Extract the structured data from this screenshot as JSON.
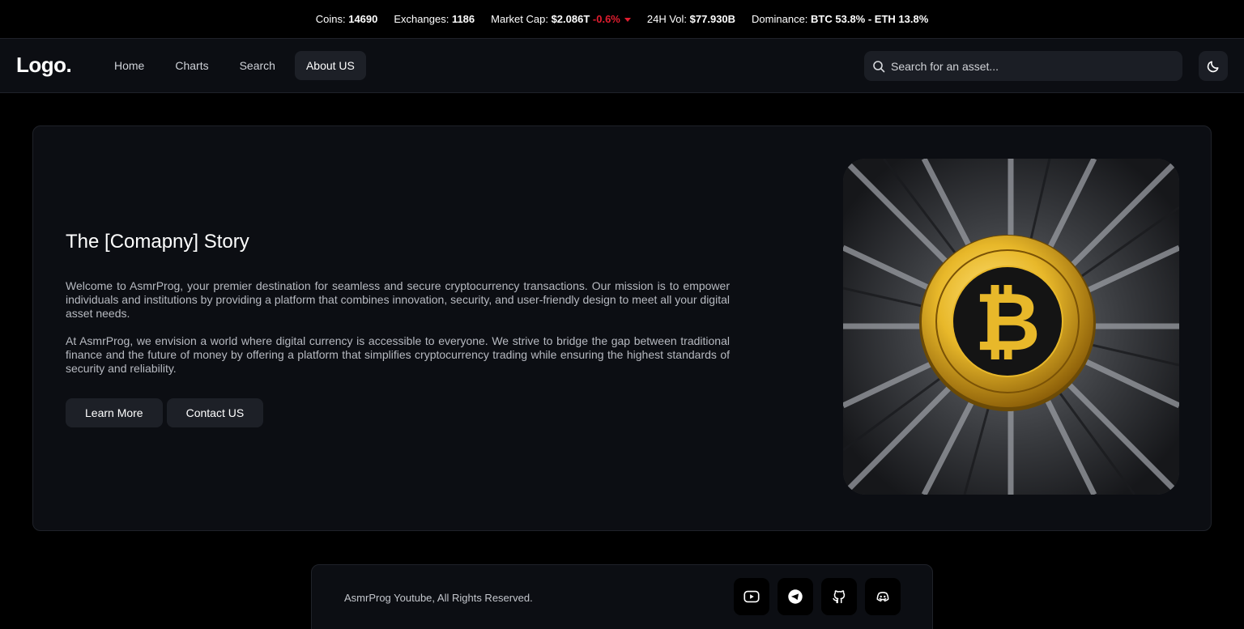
{
  "ticker": {
    "coins_label": "Coins:",
    "coins": "14690",
    "exchanges_label": "Exchanges:",
    "exchanges": "1186",
    "market_cap_label": "Market Cap:",
    "market_cap": "$2.086T",
    "market_cap_change": "-0.6%",
    "vol_label": "24H Vol:",
    "vol": "$77.930B",
    "dominance_label": "Dominance:",
    "dominance": "BTC 53.8% - ETH 13.8%"
  },
  "nav": {
    "logo": "Logo.",
    "items": [
      {
        "label": "Home",
        "active": false
      },
      {
        "label": "Charts",
        "active": false
      },
      {
        "label": "Search",
        "active": false
      },
      {
        "label": "About US",
        "active": true
      }
    ],
    "search_placeholder": "Search for an asset..."
  },
  "hero": {
    "title": "The [Comapny] Story",
    "paragraph1": "Welcome to AsmrProg, your premier destination for seamless and secure cryptocurrency transactions. Our mission is to empower individuals and institutions by providing a platform that combines innovation, security, and user-friendly design to meet all your digital asset needs.",
    "paragraph2": "At AsmrProg, we envision a world where digital currency is accessible to everyone. We strive to bridge the gap between traditional finance and the future of money by offering a platform that simplifies cryptocurrency trading while ensuring the highest standards of security and reliability.",
    "learn_more": "Learn More",
    "contact": "Contact US",
    "image_icon": "bitcoin-coin-image"
  },
  "footer": {
    "copyright": "AsmrProg Youtube, All Rights Reserved.",
    "socials": [
      "youtube-icon",
      "telegram-icon",
      "github-icon",
      "discord-icon"
    ]
  },
  "colors": {
    "negative": "#e11d2f",
    "surface": "#0c0e13",
    "button": "#1d2027",
    "gold": "#e8b82a"
  }
}
